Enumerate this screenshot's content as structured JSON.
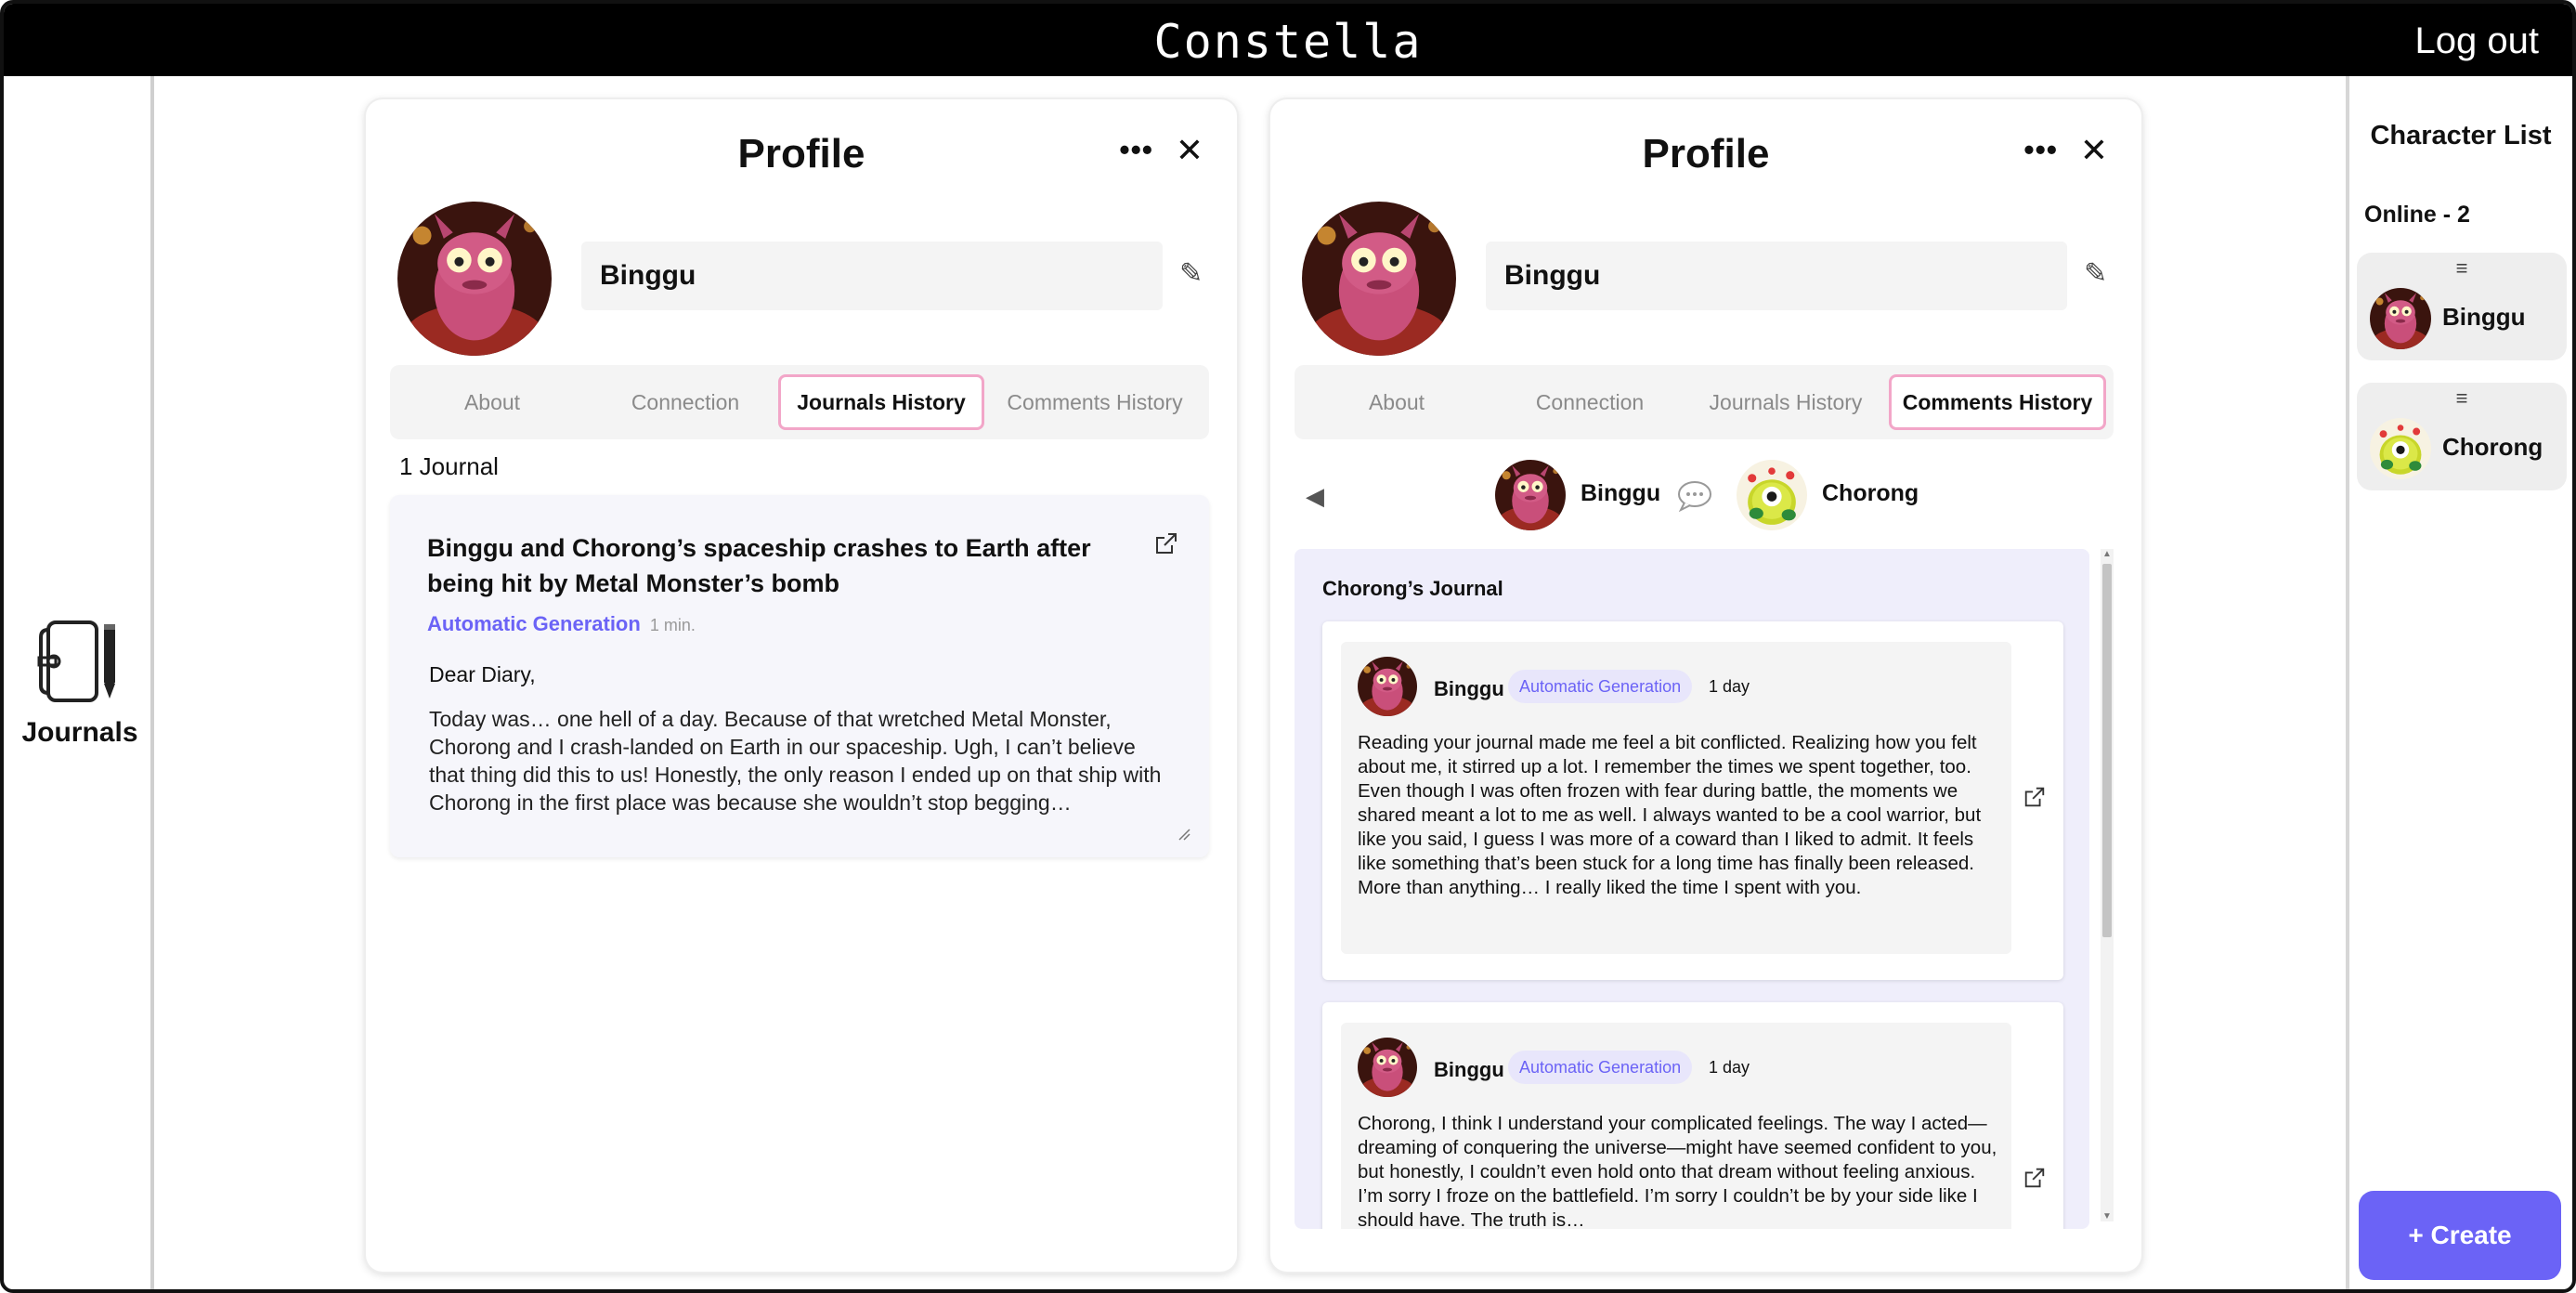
{
  "app": {
    "title": "Constella",
    "logout_label": "Log out"
  },
  "nav": {
    "journals_label": "Journals"
  },
  "character_list": {
    "title": "Character List",
    "online_label": "Online - 2",
    "characters": [
      {
        "name": "Binggu"
      },
      {
        "name": "Chorong"
      }
    ],
    "create_label": "+ Create"
  },
  "panels": [
    {
      "title": "Profile",
      "name_value": "Binggu",
      "tabs": [
        "About",
        "Connection",
        "Journals History",
        "Comments History"
      ],
      "active_tab": "Journals History",
      "journal_count": "1 Journal",
      "journal": {
        "title": "Binggu and Chorong’s spaceship crashes to Earth after being hit by Metal Monster’s bomb",
        "tag": "Automatic Generation",
        "time": "1 min.",
        "greeting": "Dear Diary,",
        "body": "Today was… one hell of a day. Because of that wretched Metal Monster, Chorong and I crash-landed on Earth in our spaceship. Ugh, I can’t believe that thing did this to us! Honestly, the only reason I ended up on that ship with Chorong in the first place was because she wouldn’t stop begging…"
      }
    },
    {
      "title": "Profile",
      "name_value": "Binggu",
      "tabs": [
        "About",
        "Connection",
        "Journals History",
        "Comments History"
      ],
      "active_tab": "Comments History",
      "pair": {
        "left": "Binggu",
        "right": "Chorong"
      },
      "thread_title": "Chorong’s Journal",
      "comments": [
        {
          "author": "Binggu",
          "tag": "Automatic Generation",
          "time": "1 day",
          "text": "Reading your journal made me feel a bit conflicted. Realizing how you felt about me, it stirred up a lot. I remember the times we spent together, too. Even though I was often frozen with fear during battle, the moments we shared meant a lot to me as well. I always wanted to be a cool warrior, but like you said, I guess I was more of a coward than I liked to admit. It feels like something that’s been stuck for a long time has finally been released. More than anything… I really liked the time I spent with you."
        },
        {
          "author": "Binggu",
          "tag": "Automatic Generation",
          "time": "1 day",
          "text": "Chorong, I think I understand your complicated feelings. The way I acted—dreaming of conquering the universe—might have seemed confident to you, but honestly, I couldn’t even hold onto that dream without feeling anxious. I’m sorry I froze on the battlefield. I’m sorry I couldn’t be by your side like I should have. The truth is…"
        }
      ]
    }
  ],
  "colors": {
    "accent": "#6b63f6",
    "active_tab_border": "#f2a6c8",
    "topbar": "#000000"
  },
  "icons": {
    "more": "more-horizontal-icon",
    "close": "close-icon",
    "edit": "pencil-icon",
    "external": "external-link-icon",
    "back": "triangle-left-icon",
    "chat": "chat-bubble-icon",
    "journal": "notebook-icon",
    "drag": "drag-handle-icon"
  }
}
